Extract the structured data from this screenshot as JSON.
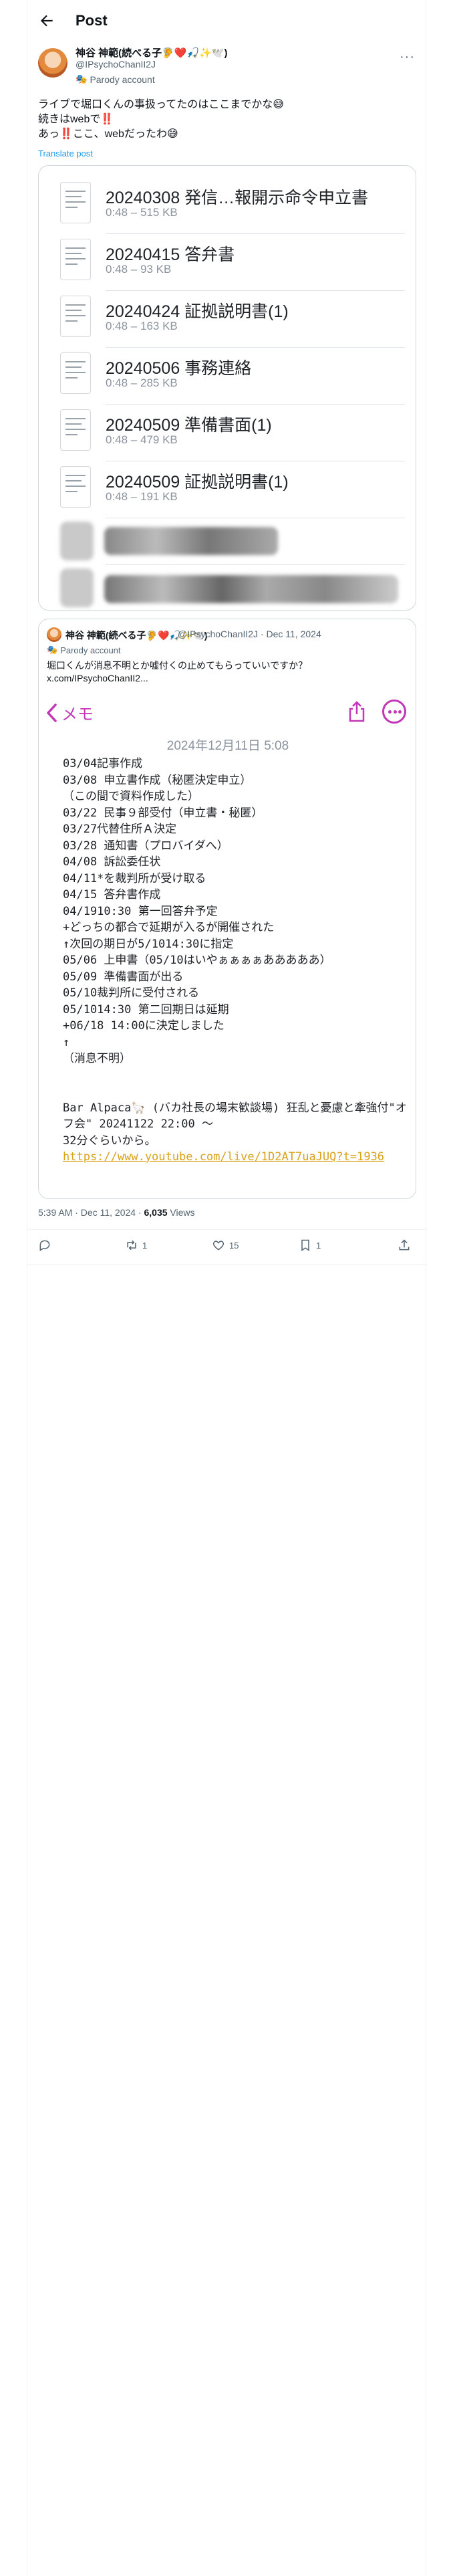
{
  "header": {
    "title": "Post"
  },
  "author": {
    "name": "神谷 神範(続べる子🦻❤️🎣✨🕊️)",
    "handle": "@IPsychoChanII2J",
    "badge": "Parody account"
  },
  "tweet": {
    "lines": [
      "ライブで堀口くんの事扱ってたのはここまでかな😅",
      "続きはwebで‼️",
      "あっ‼️ここ、webだったわ😅"
    ],
    "translate": "Translate post"
  },
  "files": [
    {
      "name": "20240308 発信…報開示命令申立書",
      "meta": "0:48 – 515 KB"
    },
    {
      "name": "20240415 答弁書",
      "meta": "0:48 – 93 KB"
    },
    {
      "name": "20240424 証拠説明書(1)",
      "meta": "0:48 – 163 KB"
    },
    {
      "name": "20240506 事務連絡",
      "meta": "0:48 – 285 KB"
    },
    {
      "name": "20240509 準備書面(1)",
      "meta": "0:48 – 479 KB"
    },
    {
      "name": "20240509 証拠説明書(1)",
      "meta": "0:48 – 191 KB"
    }
  ],
  "quote": {
    "name": "神谷 神範(続べる子🦻❤️🎣✨🕊️)",
    "handle": "@IPsychoChanII2J · Dec 11, 2024",
    "badge": "Parody account",
    "text_line1": "堀口くんが消息不明とか嘘付くの止めてもらっていいですか？",
    "text_line2": "x.com/IPsychoChanII2...",
    "memo": {
      "back_label": "メモ",
      "date": "2024年12月11日 5:08",
      "lines": [
        "03/04記事作成",
        "03/08 申立書作成（秘匿決定申立）",
        "（この間で資料作成した）",
        "03/22 民事９部受付（申立書・秘匿）",
        "03/27代替住所Ａ決定",
        "03/28 通知書（プロバイダへ）",
        "04/08 訴訟委任状",
        "04/11*を裁判所が受け取る",
        "04/15 答弁書作成",
        "04/1910:30 第一回答弁予定",
        "+どっちの都合で延期が入るが開催された",
        "↑次回の期日が5/1014:30に指定",
        "05/06 上申書（05/10はいやぁぁぁぁあああああ）",
        "05/09 準備書面が出る",
        "05/10裁判所に受付される",
        "05/1014:30 第二回期日は延期",
        "+06/18 14:00に決定しました",
        "↑",
        "（消息不明）",
        "",
        "",
        "Bar Alpaca🦙 (バカ社長の場末歓談場)  狂乱と憂慮と牽強付\"オフ会\" 20241122 22:00 〜",
        "32分ぐらいから。"
      ],
      "link": "https://www.youtube.com/live/1D2AT7uaJUQ?t=1936"
    }
  },
  "meta": {
    "time": "5:39 AM · Dec 11, 2024 · ",
    "views_count": "6,035",
    "views_label": " Views"
  },
  "actions": {
    "replies": "",
    "reposts": "1",
    "likes": "15",
    "bookmarks": "1"
  }
}
